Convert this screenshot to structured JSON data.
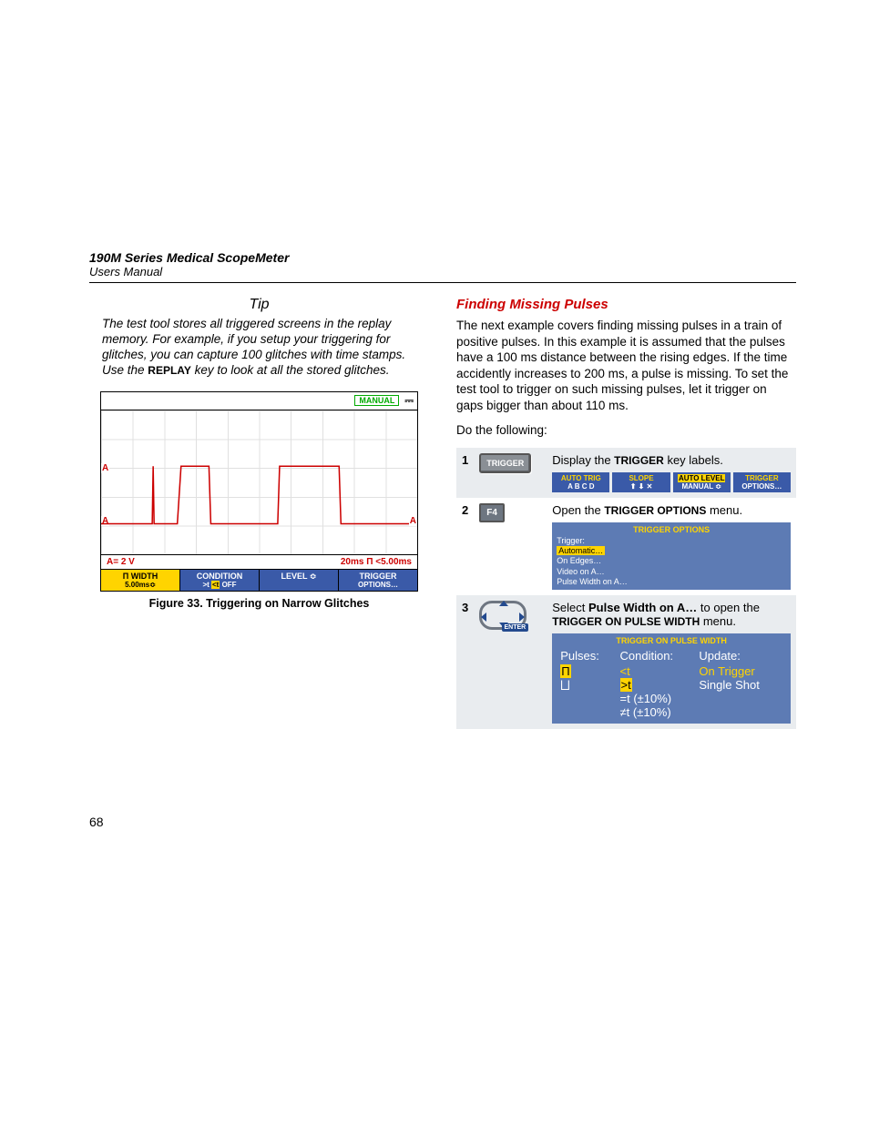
{
  "header": {
    "title": "190M Series Medical ScopeMeter",
    "subtitle": "Users Manual"
  },
  "tip": {
    "heading": "Tip",
    "body_parts": [
      "The test tool stores all triggered screens in the replay memory. For example, if you setup your triggering for glitches, you can capture 100 glitches with time stamps. Use the ",
      " key to look at all the stored glitches."
    ],
    "key": "REPLAY"
  },
  "scope": {
    "manual_badge": "MANUAL",
    "marker": "A",
    "status_left": "A= 2 V",
    "status_right": "20ms Π <5.00ms",
    "softkeys": [
      {
        "l1": "Π WIDTH",
        "l2": "5.00ms≎",
        "style": "yellow"
      },
      {
        "l1": "CONDITION",
        "l2": ">t <t OFF",
        "style": "blue",
        "hl": "<t"
      },
      {
        "l1": "LEVEL ≎",
        "l2": "",
        "style": "blue"
      },
      {
        "l1": "TRIGGER",
        "l2": "OPTIONS…",
        "style": "blue"
      }
    ]
  },
  "fig_caption": "Figure 33. Triggering on Narrow Glitches",
  "right": {
    "heading": "Finding Missing Pulses",
    "para": "The next example covers finding missing pulses in a train of positive pulses. In this example it is assumed that the pulses have a 100 ms distance between the rising edges. If the time accidently increases to 200 ms, a pulse is missing. To set the test tool to trigger on such missing pulses, let it trigger on gaps bigger than about 110 ms.",
    "lead": "Do the following:"
  },
  "steps": [
    {
      "num": "1",
      "key_label": "TRIGGER",
      "text_parts": [
        "Display the ",
        " key labels."
      ],
      "key_in_text": "TRIGGER",
      "skrow": [
        {
          "top": "AUTO TRIG",
          "bot": "A  B  C  D"
        },
        {
          "top": "SLOPE",
          "bot": "⬆  ⬇  ✕"
        },
        {
          "top": "AUTO LEVEL",
          "bot": "MANUAL ≎",
          "hl_top": true
        },
        {
          "top": "TRIGGER",
          "bot": "OPTIONS…"
        }
      ]
    },
    {
      "num": "2",
      "key_label": "F4",
      "text_parts": [
        "Open the ",
        " menu."
      ],
      "key_in_text": "TRIGGER OPTIONS",
      "optbox": {
        "title": "TRIGGER OPTIONS",
        "label": "Trigger:",
        "options": [
          "Automatic…",
          "On Edges…",
          "Video on A…",
          "Pulse Width on A…"
        ],
        "selected": 0
      }
    },
    {
      "num": "3",
      "key_label": "ENTER",
      "text_html": {
        "pre": "Select ",
        "bold": "Pulse Width on A…",
        "mid": " to open the ",
        "sc": "TRIGGER ON PULSE WIDTH",
        "post": " menu."
      },
      "pulsebox": {
        "title": "TRIGGER ON PULSE WIDTH",
        "cols": [
          "Pulses:",
          "Condition:",
          "Update:"
        ],
        "pulses": [
          "Π",
          "⨆"
        ],
        "cond": [
          "<t",
          ">t",
          "=t (±10%)",
          "≠t (±10%)"
        ],
        "cond_sel": 1,
        "update": [
          "On Trigger",
          "Single Shot"
        ]
      }
    }
  ],
  "page_number": "68"
}
